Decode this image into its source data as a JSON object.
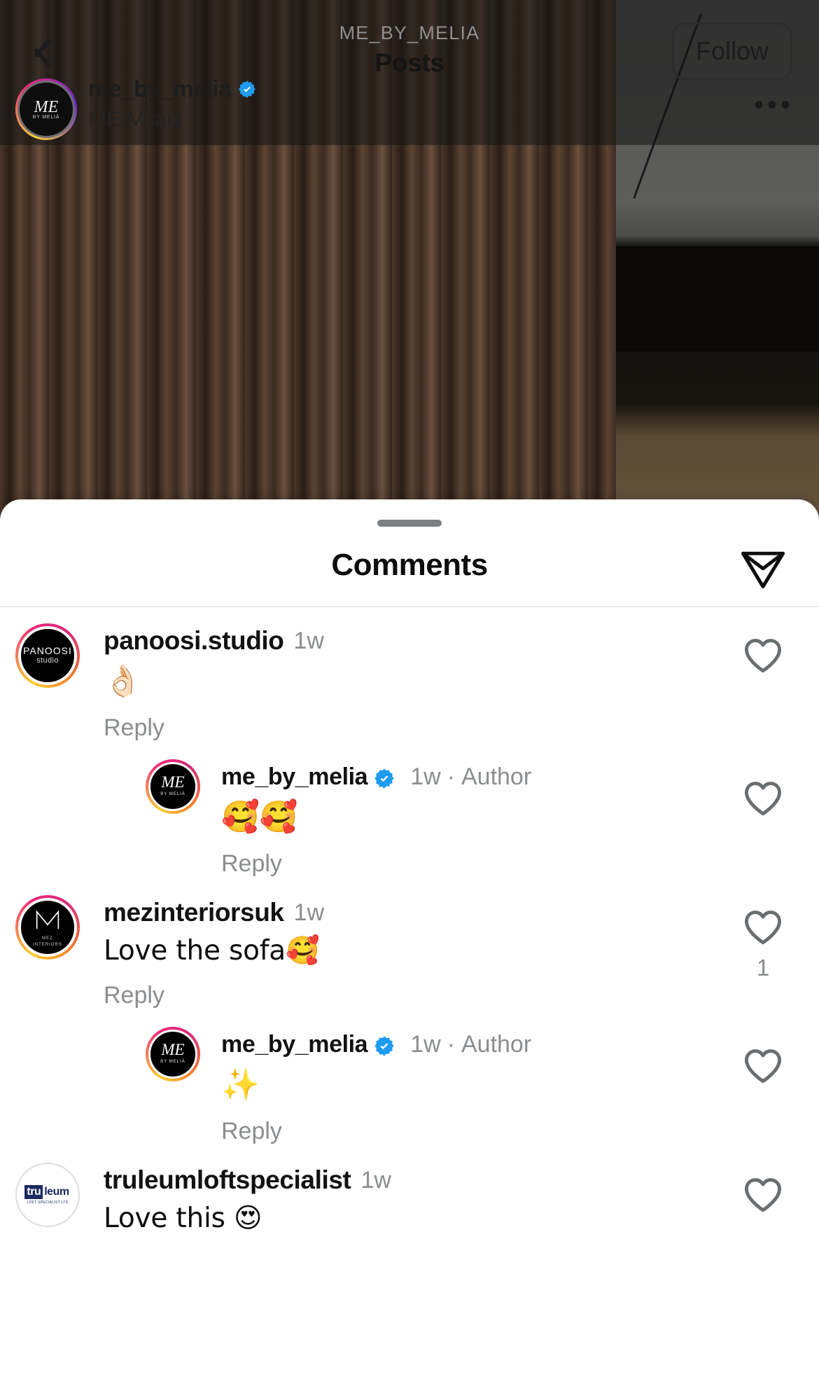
{
  "nav": {
    "back_icon": "chevron-left-icon",
    "eyebrow": "ME_BY_MELIA",
    "title": "Posts",
    "follow_label": "Follow"
  },
  "post_author": {
    "username": "me_by_melia",
    "verified": true,
    "location": "ME Milan",
    "more_icon": "ellipsis-icon",
    "avatar_text_main": "ME",
    "avatar_text_sub": "BY MELIÁ"
  },
  "sheet": {
    "title": "Comments",
    "share_icon": "paper-plane-icon",
    "grabber": "drag-handle"
  },
  "labels": {
    "reply": "Reply",
    "author": "Author",
    "separator": "·"
  },
  "colors": {
    "verified_blue": "#1d9bf0",
    "muted_text": "#8a8d8f",
    "primary_text": "#0e0e0e",
    "heart_outline": "#6a6e70",
    "truleum_navy": "#1c2a60"
  },
  "comments": [
    {
      "username": "panoosi.studio",
      "verified": false,
      "time": "1w",
      "is_author": false,
      "text": "👌🏻",
      "emoji_only": true,
      "reply_label": "Reply",
      "likes": "",
      "level": 0,
      "avatar": {
        "type": "panoosi",
        "main": "PANOOSI",
        "sub": "studio"
      }
    },
    {
      "username": "me_by_melia",
      "verified": true,
      "time": "1w",
      "is_author": true,
      "text": "🥰🥰",
      "emoji_only": true,
      "reply_label": "Reply",
      "likes": "",
      "level": 1,
      "avatar": {
        "type": "me",
        "main": "ME",
        "sub": "BY MELIÁ"
      }
    },
    {
      "username": "mezinteriorsuk",
      "verified": false,
      "time": "1w",
      "is_author": false,
      "text": "Love the sofa🥰",
      "emoji_only": false,
      "reply_label": "Reply",
      "likes": "1",
      "level": 0,
      "avatar": {
        "type": "mez",
        "main": "M",
        "sub1": "MEZ",
        "sub2": "INTERIORS"
      }
    },
    {
      "username": "me_by_melia",
      "verified": true,
      "time": "1w",
      "is_author": true,
      "text": "✨",
      "emoji_only": true,
      "reply_label": "Reply",
      "likes": "",
      "level": 1,
      "avatar": {
        "type": "me",
        "main": "ME",
        "sub": "BY MELIÁ"
      }
    },
    {
      "username": "truleumloftspecialist",
      "verified": false,
      "time": "1w",
      "is_author": false,
      "text": "Love this 😍",
      "emoji_only": false,
      "reply_label": "",
      "likes": "",
      "level": 0,
      "avatar": {
        "type": "truleum",
        "main1": "tru",
        "main2": "leum",
        "sub": "LOFT SPECIALIST LTD"
      }
    }
  ]
}
